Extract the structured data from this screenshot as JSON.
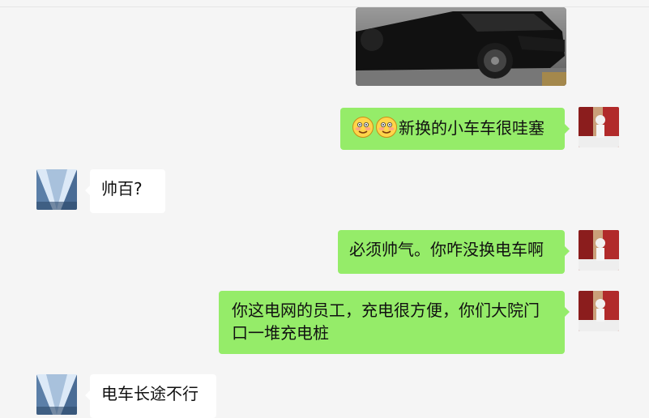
{
  "messages": [
    {
      "id": "m1",
      "side": "right",
      "type": "image",
      "alt": ""
    },
    {
      "id": "m2",
      "side": "right",
      "type": "text",
      "emojis": [
        "blush-smile-icon",
        "blush-smile-icon"
      ],
      "text": "新换的小车车很哇塞"
    },
    {
      "id": "m3",
      "side": "left",
      "type": "text",
      "text": "帅百?"
    },
    {
      "id": "m4",
      "side": "right",
      "type": "text",
      "text": "必须帅气。你咋没换电车啊"
    },
    {
      "id": "m5",
      "side": "right",
      "type": "text",
      "text": "你这电网的员工，充电很方便，你们大院门口一堆充电桩"
    },
    {
      "id": "m6",
      "side": "left",
      "type": "text",
      "text": "电车长途不行"
    }
  ],
  "colors": {
    "background": "#f5f5f5",
    "outgoing_bubble": "#95ec69",
    "incoming_bubble": "#ffffff"
  }
}
